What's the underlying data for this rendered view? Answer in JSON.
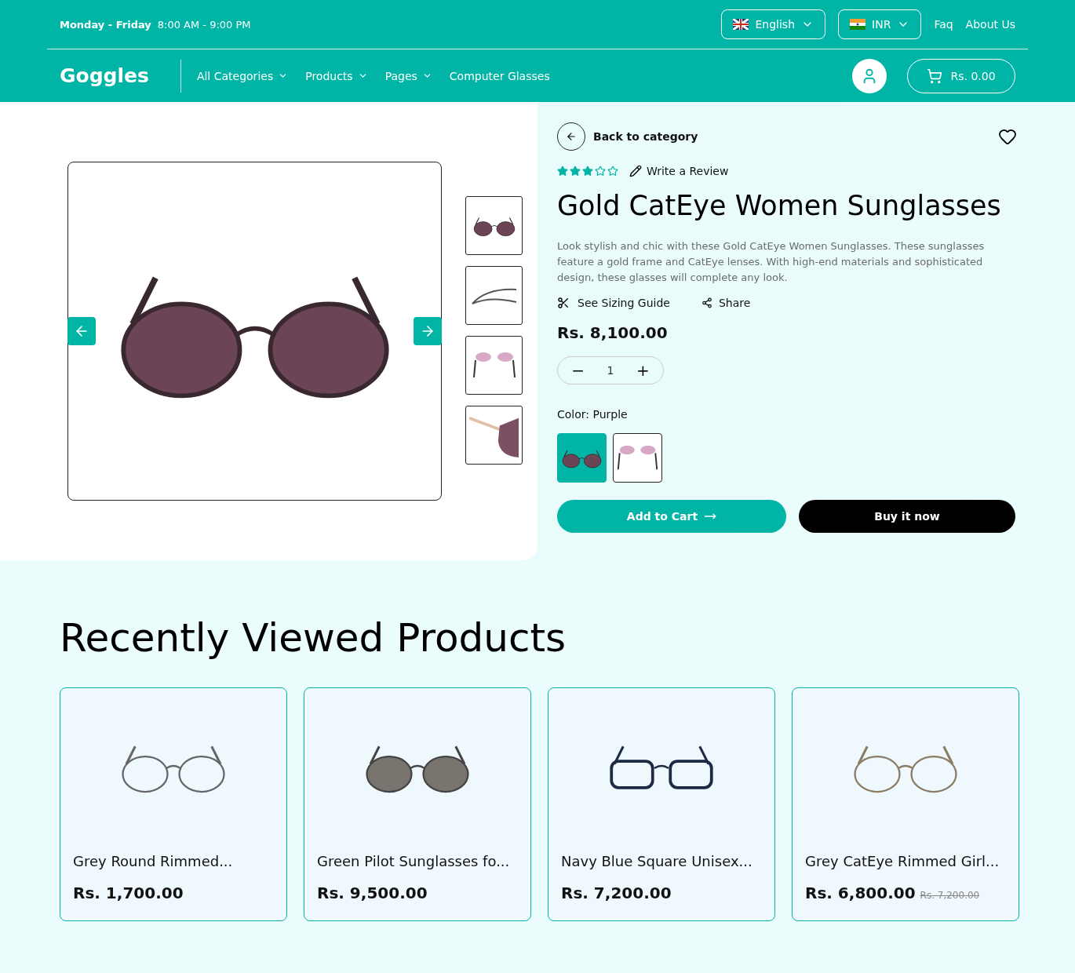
{
  "topbar": {
    "hours_days": "Monday - Friday",
    "hours_time": "8:00 AM - 9:00 PM",
    "language": "English",
    "currency": "INR",
    "links": [
      "Faq",
      "About Us"
    ]
  },
  "nav": {
    "logo": "Goggles",
    "items": [
      {
        "label": "All Categories",
        "dropdown": true
      },
      {
        "label": "Products",
        "dropdown": true
      },
      {
        "label": "Pages",
        "dropdown": true
      },
      {
        "label": "Computer Glasses",
        "dropdown": false
      }
    ],
    "cart_total": "Rs. 0.00"
  },
  "gallery": {
    "thumbnails": [
      {
        "kind": "front"
      },
      {
        "kind": "side"
      },
      {
        "kind": "back"
      },
      {
        "kind": "closeup"
      }
    ]
  },
  "product": {
    "back_label": "Back to category",
    "stars": 3,
    "review_label": "Write a Review",
    "title": "Gold CatEye Women Sunglasses",
    "description": "Look stylish and chic with these Gold CatEye Women Sunglasses. These sunglasses feature a gold frame and CatEye lenses. With high-end materials and sophisticated design, these glasses will complete any look.",
    "sizing_label": "See Sizing Guide",
    "share_label": "Share",
    "price": "Rs. 8,100.00",
    "quantity": "1",
    "minus": "−",
    "plus": "+",
    "color_label": "Color:",
    "color_value": "Purple",
    "swatches": [
      {
        "kind": "teal",
        "selected": true
      },
      {
        "kind": "white",
        "selected": false
      }
    ],
    "add_to_cart": "Add to Cart",
    "buy_now": "Buy it now"
  },
  "recent": {
    "heading": "Recently Viewed Products",
    "items": [
      {
        "name": "Grey Round Rimmed...",
        "price": "Rs. 1,700.00",
        "kind": "round"
      },
      {
        "name": "Green Pilot Sunglasses fo...",
        "price": "Rs. 9,500.00",
        "kind": "pilot"
      },
      {
        "name": "Navy Blue Square Unisex...",
        "price": "Rs. 7,200.00",
        "kind": "square"
      },
      {
        "name": "Grey CatEye Rimmed Girl...",
        "price": "Rs. 6,800.00",
        "old_price": "Rs. 7,200.00",
        "kind": "cateye"
      }
    ]
  }
}
